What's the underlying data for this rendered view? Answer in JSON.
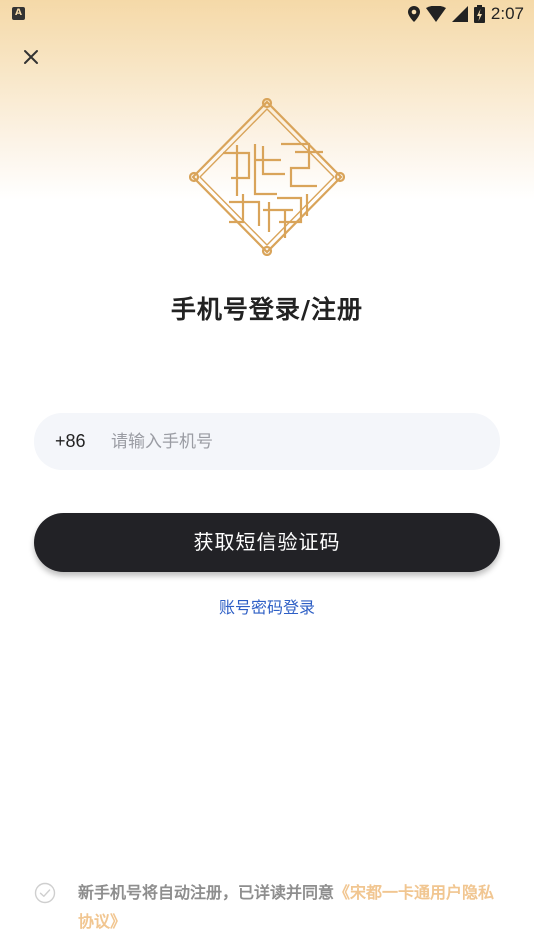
{
  "status_bar": {
    "left_badge": "A",
    "time": "2:07"
  },
  "header": {
    "title": "手机号登录/注册"
  },
  "form": {
    "country_code": "+86",
    "phone_placeholder": "请输入手机号",
    "phone_value": "",
    "sms_button_label": "获取短信验证码",
    "password_login_link": "账号密码登录"
  },
  "agreement": {
    "text": "新手机号将自动注册，已详读并同意",
    "link": "《宋都一卡通用户隐私协议》",
    "checked": false
  },
  "colors": {
    "accent_gold": "#d9a45a",
    "link_blue": "#2e5fc5",
    "button_dark": "#222226",
    "agreement_link": "#f1c691"
  },
  "icons": {
    "close": "close-icon",
    "location": "location-icon",
    "wifi": "wifi-icon",
    "signal": "signal-icon",
    "battery": "battery-icon",
    "check": "check-circle-icon",
    "logo": "brand-logo"
  }
}
